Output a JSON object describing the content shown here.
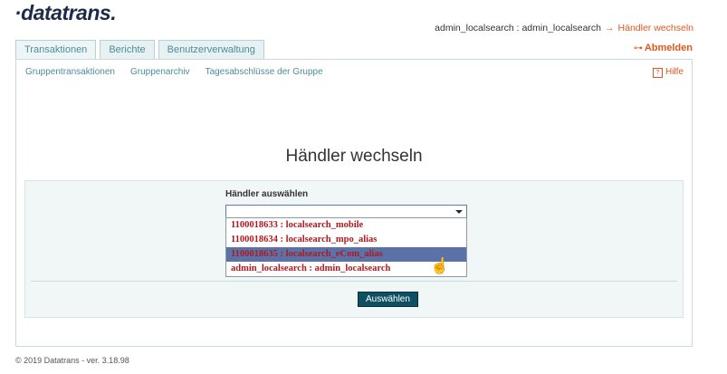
{
  "brand": {
    "logo": "·datatrans."
  },
  "header": {
    "user": "admin_localsearch : admin_localsearch",
    "arrow": "→",
    "switch_link": "Händler wechseln",
    "logout_icon": "key-icon",
    "logout_glyph": "⊶",
    "logout_label": "Abmelden"
  },
  "tabs": [
    {
      "label": "Transaktionen"
    },
    {
      "label": "Berichte"
    },
    {
      "label": "Benutzerverwaltung"
    }
  ],
  "subnav": {
    "items": [
      {
        "label": "Gruppentransaktionen"
      },
      {
        "label": "Gruppenarchiv"
      },
      {
        "label": "Tagesabschlüsse der Gruppe"
      }
    ],
    "help_glyph": "?",
    "help_label": "Hilfe"
  },
  "main": {
    "title": "Händler wechseln",
    "field_label": "Händler auswählen",
    "select_value": "",
    "submit_label": "Auswählen"
  },
  "dropdown": {
    "options": [
      {
        "label": "1100018633 : localsearch_mobile"
      },
      {
        "label": "1100018634 : localsearch_mpo_alias"
      },
      {
        "label": "1100018635 : localsearch_eCom_alias"
      },
      {
        "label": "admin_localsearch : admin_localsearch"
      }
    ],
    "highlighted_index": 2
  },
  "footer": {
    "text": "© 2019 Datatrans - ver. 3.18.98"
  },
  "colors": {
    "accent": "#e0571f",
    "brand": "#1d2a4c",
    "teal": "#4d8c9a",
    "button": "#0f4f62",
    "highlight": "#5a72a7",
    "option_text": "#b3181e"
  }
}
